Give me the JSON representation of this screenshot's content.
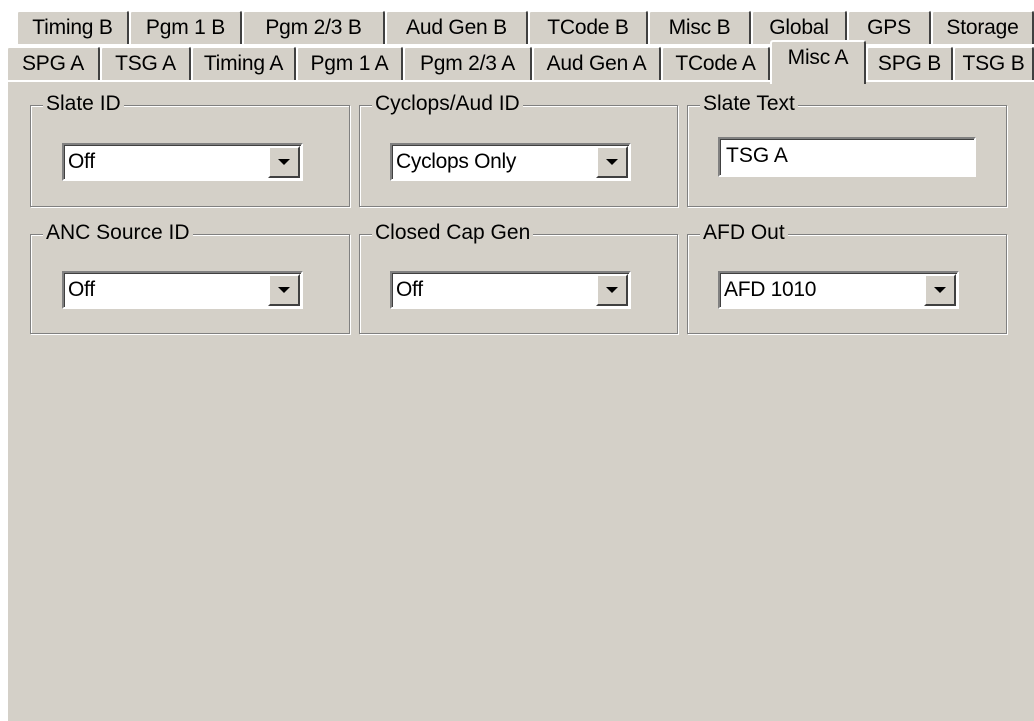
{
  "tabs_back": [
    "Timing B",
    "Pgm 1 B",
    "Pgm 2/3 B",
    "Aud Gen B",
    "TCode B",
    "Misc B",
    "Global",
    "GPS",
    "Storage"
  ],
  "tabs_front": [
    "SPG A",
    "TSG A",
    "Timing A",
    "Pgm 1 A",
    "Pgm 2/3 A",
    "Aud Gen A",
    "TCode A",
    "Misc A",
    "SPG B",
    "TSG B"
  ],
  "active_tab": "Misc A",
  "groups": {
    "slate_id": {
      "title": "Slate ID",
      "value": "Off"
    },
    "cyclops_aud_id": {
      "title": "Cyclops/Aud ID",
      "value": "Cyclops Only"
    },
    "slate_text": {
      "title": "Slate Text",
      "value": "TSG A"
    },
    "anc_source_id": {
      "title": "ANC Source ID",
      "value": "Off"
    },
    "closed_cap_gen": {
      "title": "Closed Cap Gen",
      "value": "Off"
    },
    "afd_out": {
      "title": "AFD Out",
      "value": "AFD 1010"
    }
  },
  "icons": {
    "dropdown": "chevron-down-icon"
  },
  "colors": {
    "face": "#d4d0c8",
    "highlight": "#ffffff",
    "shadow": "#808080",
    "dark_shadow": "#404040"
  }
}
